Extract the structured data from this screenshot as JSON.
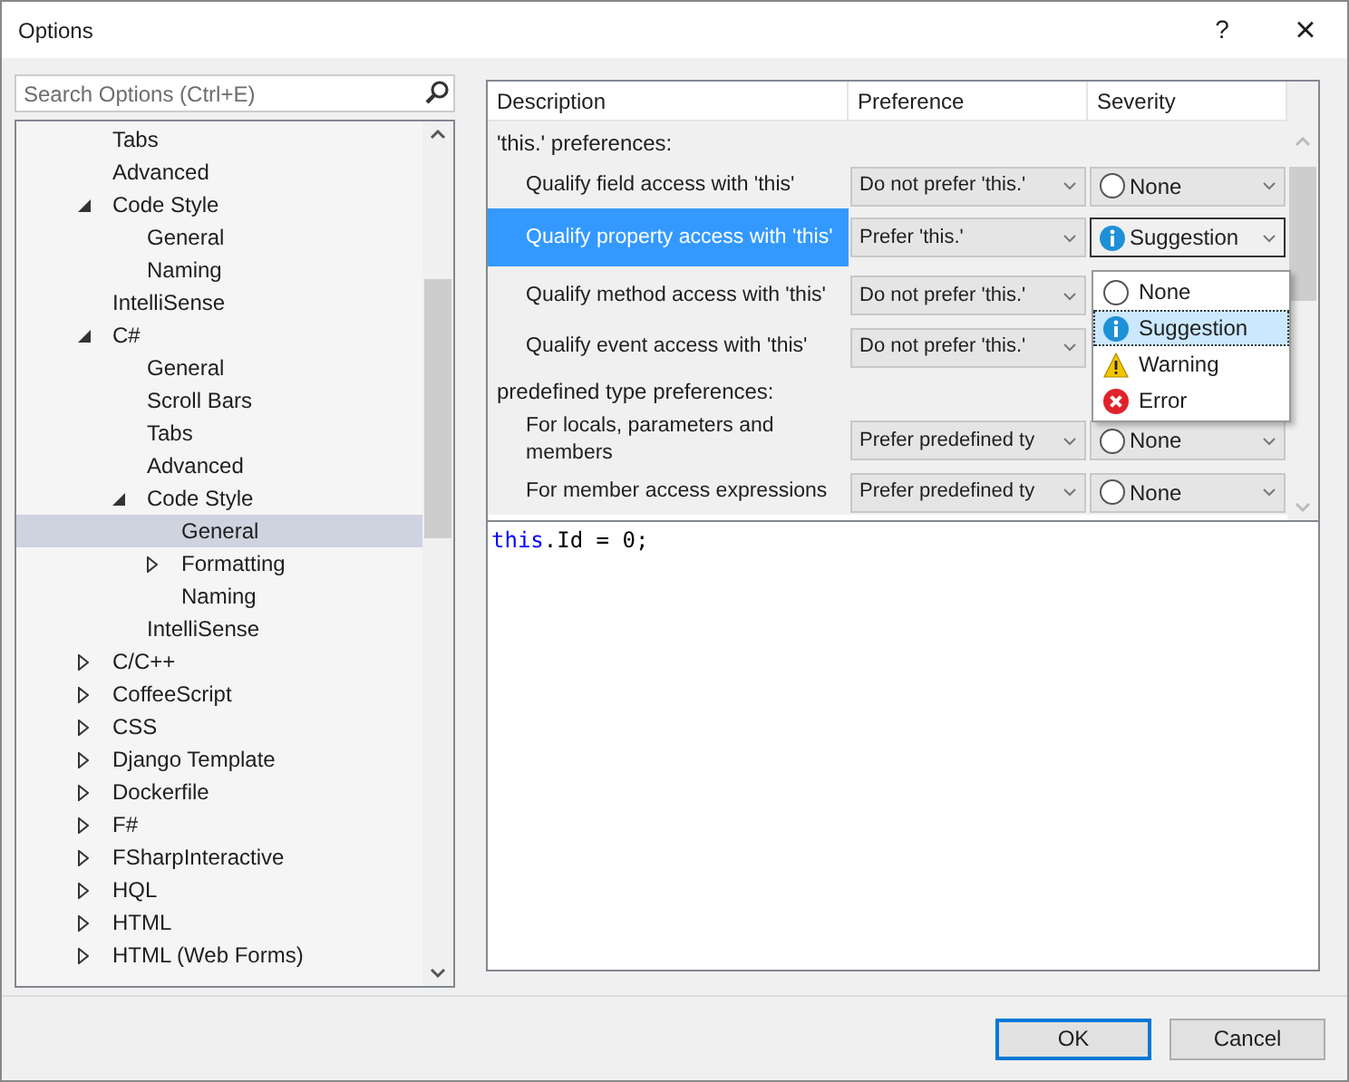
{
  "window": {
    "title": "Options",
    "help": "?",
    "close": "×"
  },
  "search": {
    "placeholder": "Search Options (Ctrl+E)"
  },
  "tree": [
    {
      "children": [
        {
          "label": "Tabs",
          "selected": false
        },
        {
          "label": "Advanced",
          "selected": false
        },
        {
          "label": "Code Style",
          "expanded": true,
          "selected": false,
          "children": [
            {
              "label": "General",
              "selected": false
            },
            {
              "label": "Naming",
              "selected": false
            }
          ]
        },
        {
          "label": "IntelliSense",
          "selected": false
        }
      ]
    },
    {
      "label": "C#",
      "expanded": true,
      "selected": false,
      "children": [
        {
          "label": "General",
          "selected": false
        },
        {
          "label": "Scroll Bars",
          "selected": false
        },
        {
          "label": "Tabs",
          "selected": false
        },
        {
          "label": "Advanced",
          "selected": false
        },
        {
          "label": "Code Style",
          "expanded": true,
          "selected": false,
          "children": [
            {
              "label": "General",
              "selected": true
            },
            {
              "label": "Formatting",
              "expanded": false,
              "selected": false
            },
            {
              "label": "Naming",
              "selected": false
            }
          ]
        },
        {
          "label": "IntelliSense",
          "selected": false
        }
      ]
    },
    {
      "label": "C/C++",
      "expanded": false,
      "selected": false
    },
    {
      "label": "CoffeeScript",
      "expanded": false,
      "selected": false
    },
    {
      "label": "CSS",
      "expanded": false,
      "selected": false
    },
    {
      "label": "Django Template",
      "expanded": false,
      "selected": false
    },
    {
      "label": "Dockerfile",
      "expanded": false,
      "selected": false
    },
    {
      "label": "F#",
      "expanded": false,
      "selected": false
    },
    {
      "label": "FSharpInteractive",
      "expanded": false,
      "selected": false
    },
    {
      "label": "HQL",
      "expanded": false,
      "selected": false
    },
    {
      "label": "HTML",
      "expanded": false,
      "selected": false
    },
    {
      "label": "HTML (Web Forms)",
      "expanded": false,
      "selected": false
    }
  ],
  "grid": {
    "columns": [
      "Description",
      "Preference",
      "Severity"
    ],
    "rows": [
      {
        "kind": "group",
        "description": "'this.' preferences:"
      },
      {
        "kind": "option",
        "description": "Qualify field access with 'this'",
        "preference": "Do not prefer 'this.'",
        "severity": {
          "label": "None",
          "kind": "none"
        },
        "selected": false
      },
      {
        "kind": "option",
        "description": "Qualify property access with 'this'",
        "preference": "Prefer 'this.'",
        "severity": {
          "label": "Suggestion",
          "kind": "suggestion"
        },
        "selected": true
      },
      {
        "kind": "option",
        "description": "Qualify method access with 'this'",
        "preference": "Do not prefer 'this.'",
        "selected": false
      },
      {
        "kind": "option",
        "description": "Qualify event access with 'this'",
        "preference": "Do not prefer 'this.'",
        "selected": false
      },
      {
        "kind": "group",
        "description": "predefined type preferences:"
      },
      {
        "kind": "option",
        "description": "For locals, parameters and members",
        "preference": "Prefer predefined ty",
        "severity": {
          "label": "None",
          "kind": "none"
        },
        "selected": false
      },
      {
        "kind": "option",
        "description": "For member access expressions",
        "preference": "Prefer predefined ty",
        "severity": {
          "label": "None",
          "kind": "none"
        },
        "selected": false
      }
    ],
    "dropdown": [
      {
        "label": "None",
        "kind": "none",
        "selected": false
      },
      {
        "label": "Suggestion",
        "kind": "suggestion",
        "selected": true
      },
      {
        "label": "Warning",
        "kind": "warning",
        "selected": false
      },
      {
        "label": "Error",
        "kind": "error",
        "selected": false
      }
    ]
  },
  "preview": [
    {
      "text": "this",
      "kind": "keyword"
    },
    {
      "text": ".Id = 0;",
      "kind": "plain"
    }
  ],
  "buttons": [
    {
      "label": "OK",
      "default": true
    },
    {
      "label": "Cancel",
      "default": false
    }
  ]
}
